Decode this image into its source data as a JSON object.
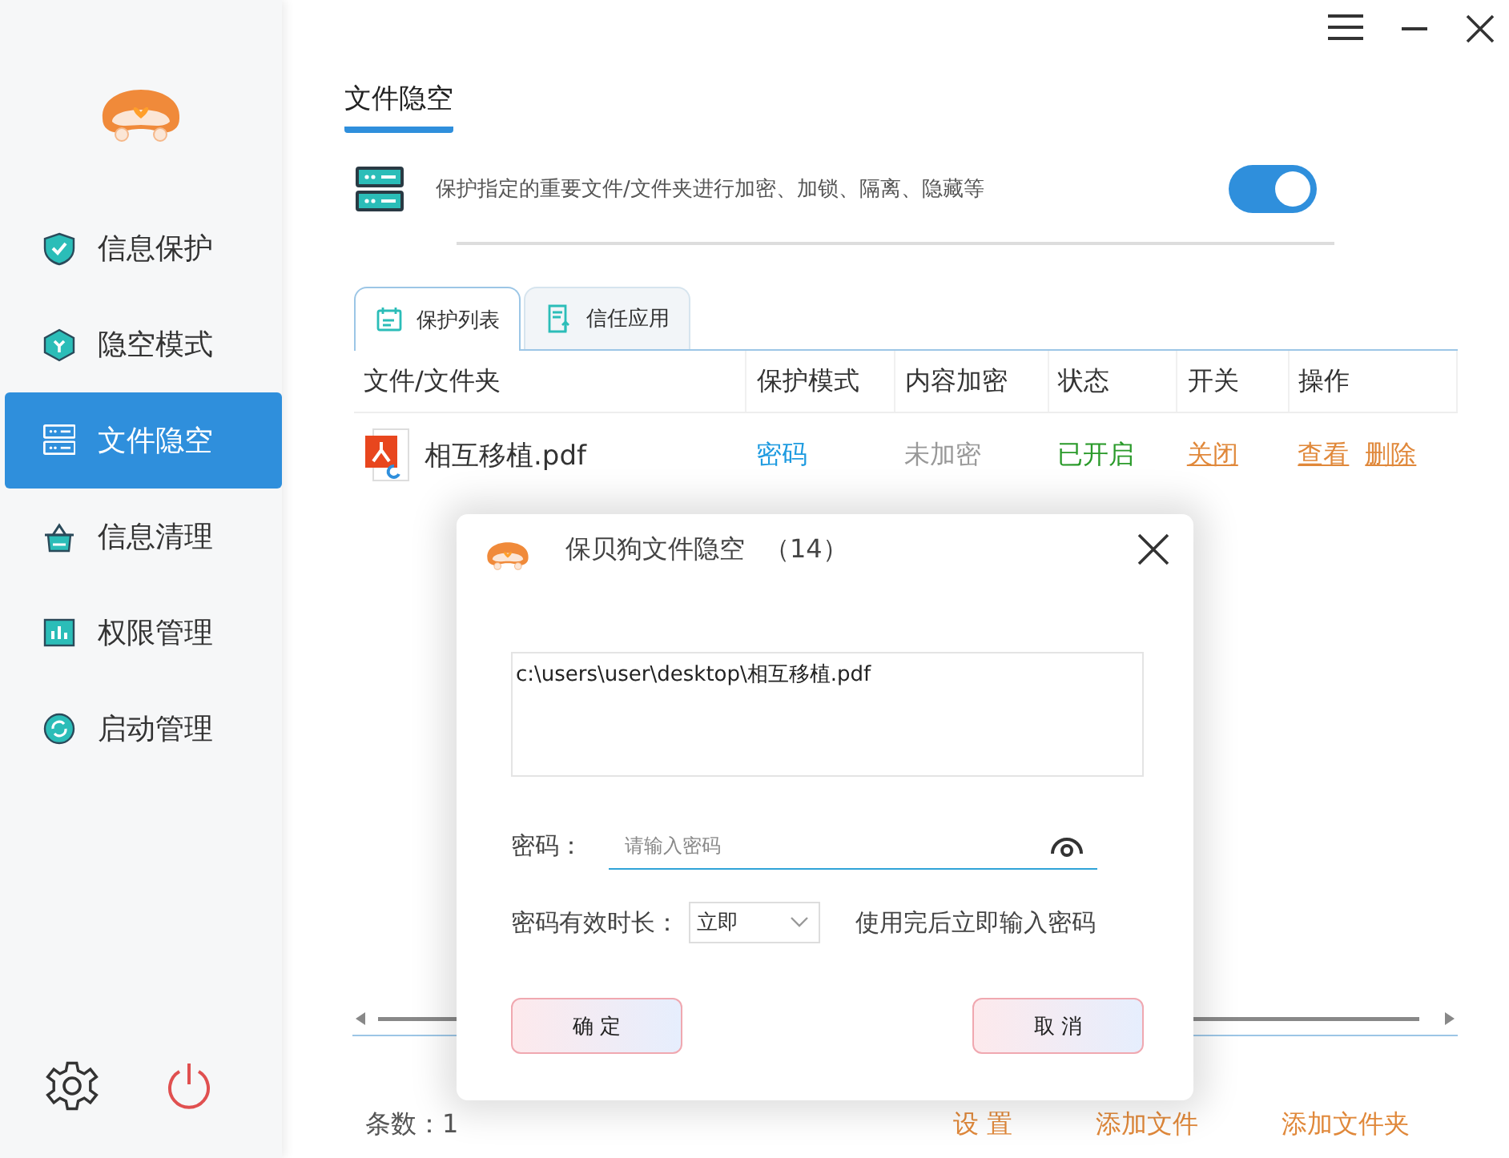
{
  "sidebar": {
    "items": [
      {
        "label": "信息保护",
        "selected": false
      },
      {
        "label": "隐空模式",
        "selected": false
      },
      {
        "label": "文件隐空",
        "selected": true
      },
      {
        "label": "信息清理",
        "selected": false
      },
      {
        "label": "权限管理",
        "selected": false
      },
      {
        "label": "启动管理",
        "selected": false
      }
    ]
  },
  "page_tab": {
    "label": "文件隐空",
    "selected": true
  },
  "feature": {
    "description": "保护指定的重要文件/文件夹进行加密、加锁、隔离、隐藏等",
    "on": true
  },
  "tabs": [
    {
      "label": "保护列表",
      "selected": true
    },
    {
      "label": "信任应用",
      "selected": false
    }
  ],
  "table": {
    "columns": [
      "文件/文件夹",
      "保护模式",
      "内容加密",
      "状态",
      "开关",
      "操作"
    ],
    "rows": [
      {
        "file": "相互移植.pdf",
        "mode": "密码",
        "encryption": "未加密",
        "status": "已开启",
        "switch": "关闭",
        "actions": [
          "查看",
          "删除"
        ]
      }
    ]
  },
  "footer": {
    "count": "条数：1",
    "links": [
      "设 置",
      "添加文件",
      "添加文件夹"
    ]
  },
  "dialog": {
    "title": "保贝狗文件隐空",
    "count": "（14）",
    "path": "c:\\users\\user\\desktop\\相互移植.pdf",
    "password_label": "密码：",
    "password_placeholder": "请输入密码",
    "duration_label": "密码有效时长：",
    "duration_value": "立即",
    "duration_note": "使用完后立即输入密码",
    "buttons": [
      "确 定",
      "取 消"
    ]
  }
}
